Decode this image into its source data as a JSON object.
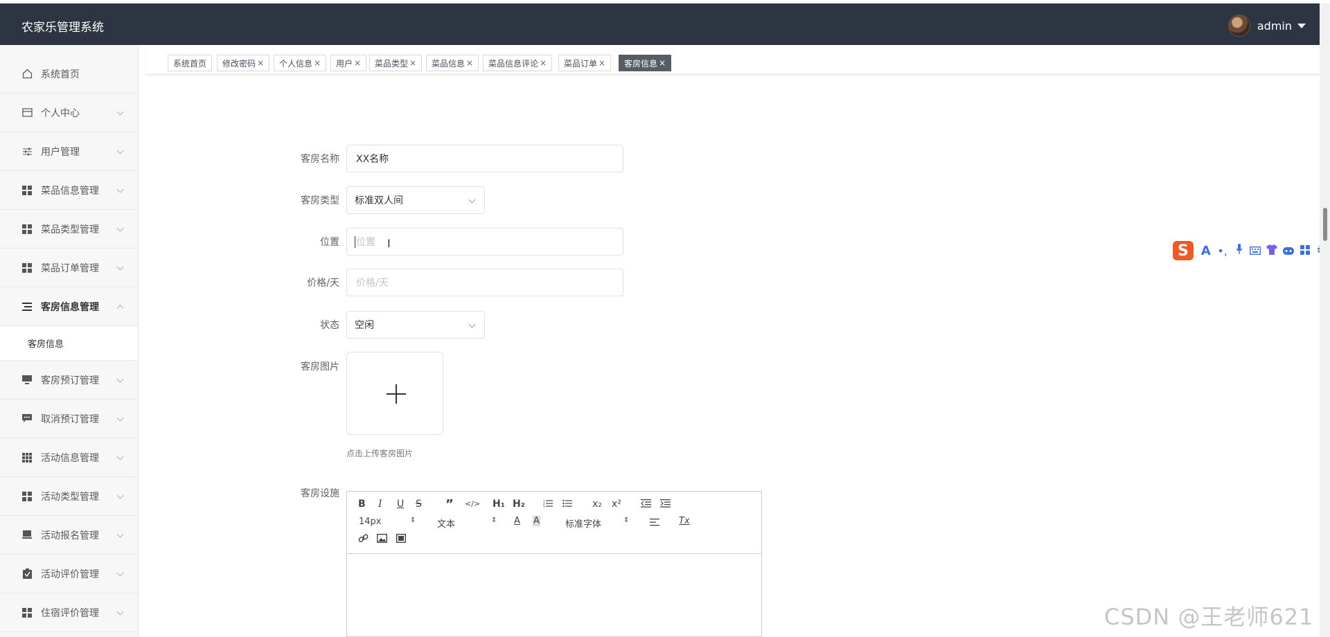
{
  "header": {
    "app_title": "农家乐管理系统",
    "username": "admin"
  },
  "sidebar": {
    "items": [
      {
        "label": "系统首页",
        "icon": "home-icon"
      },
      {
        "label": "个人中心",
        "icon": "id-card-icon"
      },
      {
        "label": "用户管理",
        "icon": "sliders-icon"
      },
      {
        "label": "菜品信息管理",
        "icon": "grid-icon"
      },
      {
        "label": "菜品类型管理",
        "icon": "grid-icon"
      },
      {
        "label": "菜品订单管理",
        "icon": "grid-icon"
      },
      {
        "label": "客房信息管理",
        "icon": "list-icon"
      },
      {
        "label": "客房预订管理",
        "icon": "monitor-icon"
      },
      {
        "label": "取消预订管理",
        "icon": "chat-icon"
      },
      {
        "label": "活动信息管理",
        "icon": "grid-9-icon"
      },
      {
        "label": "活动类型管理",
        "icon": "grid-icon"
      },
      {
        "label": "活动报名管理",
        "icon": "laptop-icon"
      },
      {
        "label": "活动评价管理",
        "icon": "clipboard-icon"
      },
      {
        "label": "住宿评价管理",
        "icon": "grid-icon"
      }
    ],
    "submenu_active": "客房信息"
  },
  "tabs": [
    {
      "label": "系统首页",
      "closable": false
    },
    {
      "label": "修改密码",
      "closable": true
    },
    {
      "label": "个人信息",
      "closable": true
    },
    {
      "label": "用户",
      "closable": true
    },
    {
      "label": "菜品类型",
      "closable": true
    },
    {
      "label": "菜品信息",
      "closable": true
    },
    {
      "label": "菜品信息评论",
      "closable": true
    },
    {
      "label": "菜品订单",
      "closable": true
    },
    {
      "label": "客房信息",
      "closable": true,
      "active": true
    }
  ],
  "tab_close_glyph": "×",
  "form": {
    "room_name_label": "客房名称",
    "room_name_value": "XX名称",
    "room_type_label": "客房类型",
    "room_type_value": "标准双人间",
    "location_label": "位置",
    "location_placeholder": "位置",
    "price_label": "价格/天",
    "price_placeholder": "价格/天",
    "status_label": "状态",
    "status_value": "空闲",
    "image_label": "客房图片",
    "upload_tip": "点击上传客房图片",
    "facilities_label": "客房设施"
  },
  "editor": {
    "font_size": "14px",
    "block_format": "文本",
    "font_family": "标准字体",
    "buttons": {
      "bold": "B",
      "italic": "I",
      "underline": "U",
      "strike": "S",
      "h1": "H₁",
      "h2": "H₂",
      "sub": "x₂",
      "sup": "x²",
      "font_color": "A",
      "bg_color": "A",
      "clear": "Tx",
      "code": "</>"
    }
  },
  "watermark": "CSDN @王老师621",
  "ime_logo": "S",
  "colors": {
    "header_bg": "#2c3541",
    "active_tab": "#555d66",
    "ime_brand": "#f05a22"
  }
}
